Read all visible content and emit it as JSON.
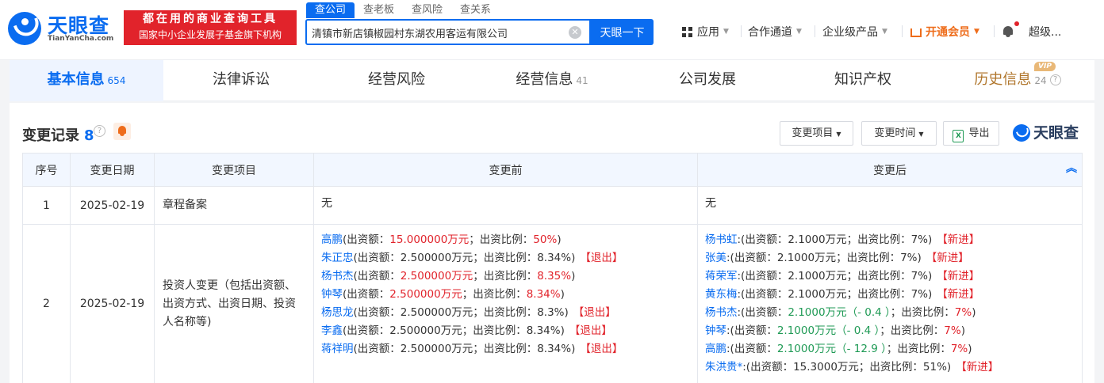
{
  "header": {
    "logo_cn": "天眼查",
    "logo_en": "TianYanCha.com",
    "slogan_line1": "都在用的商业查询工具",
    "slogan_line2": "国家中小企业发展子基金旗下机构",
    "search_tabs": [
      "查公司",
      "查老板",
      "查风险",
      "查关系"
    ],
    "search_value": "清镇市新店镇椒园村东湖农用客运有限公司",
    "clear_symbol": "✕",
    "search_button": "天眼一下",
    "nav": {
      "apps": "应用",
      "partners": "合作通道",
      "enterprise": "企业级产品",
      "vip": "开通会员",
      "user": "超级..."
    }
  },
  "category_tabs": [
    {
      "label": "基本信息",
      "count": "654"
    },
    {
      "label": "法律诉讼",
      "count": ""
    },
    {
      "label": "经营风险",
      "count": ""
    },
    {
      "label": "经营信息",
      "count": "41"
    },
    {
      "label": "公司发展",
      "count": ""
    },
    {
      "label": "知识产权",
      "count": ""
    },
    {
      "label": "历史信息",
      "count": "24"
    }
  ],
  "vip_badge": "VIP",
  "section": {
    "title": "变更记录",
    "count": "8",
    "q": "?",
    "filter_item": "变更项目",
    "filter_time": "变更时间",
    "export": "导出",
    "export_icon_letter": "X",
    "brand": "天眼查"
  },
  "table": {
    "headers": {
      "no": "序号",
      "date": "变更日期",
      "item": "变更项目",
      "before": "变更前",
      "after": "变更后"
    },
    "collapse_symbol": "︽",
    "row1": {
      "no": "1",
      "date": "2025-02-19",
      "item": "章程备案",
      "before": "无",
      "after": "无"
    },
    "row2": {
      "no": "2",
      "date": "2025-02-19",
      "item": "投资人变更（包括出资额、出资方式、出资日期、投资人名称等)",
      "before": [
        {
          "name": "高鹏",
          "a": "(出资额：",
          "amount": "15.000000万元",
          "b": "；出资比例：",
          "ratio": "50%",
          "c": ")",
          "tag": "",
          "red": true
        },
        {
          "name": "朱正忠",
          "a": "(出资额：",
          "amount": "2.500000万元",
          "b": "；出资比例：",
          "ratio": "8.34%",
          "c": ")",
          "tag": "【退出】",
          "red": false
        },
        {
          "name": "杨书杰",
          "a": "(出资额：",
          "amount": "2.500000万元",
          "b": "；出资比例：",
          "ratio": "8.35%",
          "c": ")",
          "tag": "",
          "red": true
        },
        {
          "name": "钟琴",
          "a": "(出资额：",
          "amount": "2.500000万元",
          "b": "；出资比例：",
          "ratio": "8.34%",
          "c": ")",
          "tag": "",
          "red": true
        },
        {
          "name": "杨思龙",
          "a": "(出资额：",
          "amount": "2.500000万元",
          "b": "；出资比例：",
          "ratio": "8.3%",
          "c": ")",
          "tag": "【退出】",
          "red": false
        },
        {
          "name": "李鑫",
          "a": "(出资额：",
          "amount": "2.500000万元",
          "b": "；出资比例：",
          "ratio": "8.34%",
          "c": ")",
          "tag": "【退出】",
          "red": false
        },
        {
          "name": "蒋祥明",
          "a": "(出资额：",
          "amount": "2.500000万元",
          "b": "；出资比例：",
          "ratio": "8.34%",
          "c": ")",
          "tag": "【退出】",
          "red": false
        }
      ],
      "after": [
        {
          "name": "杨书虹",
          "a": ":(出资额：",
          "amount": "2.1000万元",
          "change": "",
          "b": "；出资比例：",
          "ratio": "7%",
          "c": ")",
          "tag": "【新进】",
          "hl": false
        },
        {
          "name": "张美",
          "a": ":(出资额：",
          "amount": "2.1000万元",
          "change": "",
          "b": "；出资比例：",
          "ratio": "7%",
          "c": ")",
          "tag": "【新进】",
          "hl": false
        },
        {
          "name": "蒋荣军",
          "a": ":(出资额：",
          "amount": "2.1000万元",
          "change": "",
          "b": "；出资比例：",
          "ratio": "7%",
          "c": ")",
          "tag": "【新进】",
          "hl": false
        },
        {
          "name": "黄东梅",
          "a": ":(出资额：",
          "amount": "2.1000万元",
          "change": "",
          "b": "；出资比例：",
          "ratio": "7%",
          "c": ")",
          "tag": "【新进】",
          "hl": false
        },
        {
          "name": "杨书杰",
          "a": ":(出资额：",
          "amount": "2.1000万元",
          "change": "（- 0.4 ）",
          "b": "；出资比例：",
          "ratio": "7%",
          "c": ")",
          "tag": "",
          "hl": true
        },
        {
          "name": "钟琴",
          "a": ":(出资额：",
          "amount": "2.1000万元",
          "change": "（- 0.4 ）",
          "b": "；出资比例：",
          "ratio": "7%",
          "c": ")",
          "tag": "",
          "hl": true
        },
        {
          "name": "高鹏",
          "a": ":(出资额：",
          "amount": "2.1000万元",
          "change": "（- 12.9 ）",
          "b": "；出资比例：",
          "ratio": "7%",
          "c": ")",
          "tag": "",
          "hl": true
        },
        {
          "name": "朱洪贵*",
          "a": ":(出资额：",
          "amount": "15.3000万元",
          "change": "",
          "b": "；出资比例：",
          "ratio": "51%",
          "c": ")",
          "tag": "【新进】",
          "hl": false
        }
      ]
    }
  },
  "colors": {
    "brand_blue": "#0a6cf0",
    "red": "#e1232b",
    "green": "#1f9a55",
    "vip_orange": "#ee6c1a",
    "history_gold": "#b0762c"
  }
}
